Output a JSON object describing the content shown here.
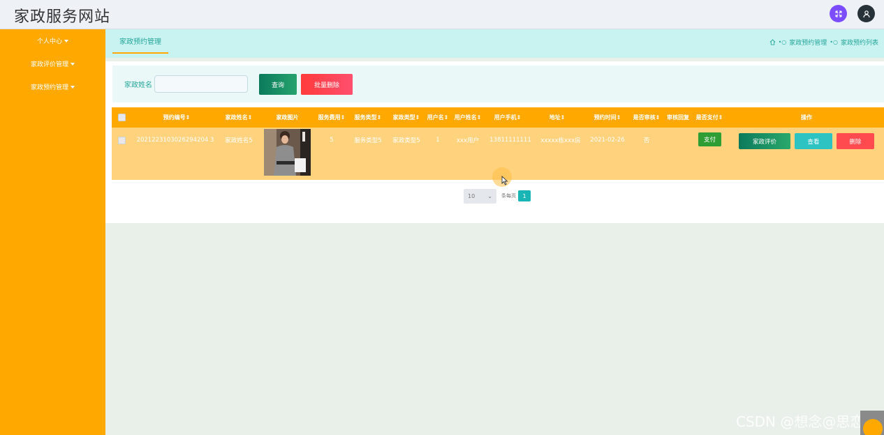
{
  "app": {
    "title": "家政服务网站"
  },
  "icons": {
    "fullscreen": "fullscreen-toggle-icon",
    "user": "user-avatar-icon",
    "home": "home-icon",
    "cursor": "mouse-pointer-icon"
  },
  "colors": {
    "accent": "#ffa800",
    "teal": "#26a69a",
    "topbar": "#eef2f7"
  },
  "sidebar": {
    "items": [
      {
        "label": "个人中心"
      },
      {
        "label": "家政评价管理"
      },
      {
        "label": "家政预约管理"
      }
    ]
  },
  "tab": {
    "label": "家政预约管理"
  },
  "breadcrumb": {
    "items": [
      "家政预约管理",
      "家政预约列表"
    ]
  },
  "search": {
    "label": "家政姓名",
    "value": "",
    "placeholder": "",
    "query_button": "查询",
    "batch_delete_button": "批量删除"
  },
  "table": {
    "headers": [
      "预约编号",
      "家政姓名",
      "家政图片",
      "服务费用",
      "服务类型",
      "家政类型",
      "用户名",
      "用户姓名",
      "用户手机",
      "地址",
      "预约时间",
      "是否审核",
      "审核回复",
      "是否支付",
      "操作"
    ],
    "rows": [
      {
        "id": "2021223103026294204 3",
        "housekeeper_name": "家政姓名5",
        "fee": "5",
        "service_type": "服务类型5",
        "housekeeping_type": "家政类型5",
        "username": "1",
        "user_realname": "xxx用户",
        "phone": "13811111111",
        "address": "xxxxx栋xxx房",
        "date": "2021-02-26",
        "audit": "否",
        "reply": "",
        "pay_button": "支付",
        "review_button": "家政评价",
        "view_button": "查看",
        "delete_button": "删除"
      }
    ]
  },
  "pagination": {
    "page_size": "10",
    "per_page_label": "条每页",
    "current_page": "1"
  },
  "watermark": "CSDN @想念@思恋"
}
